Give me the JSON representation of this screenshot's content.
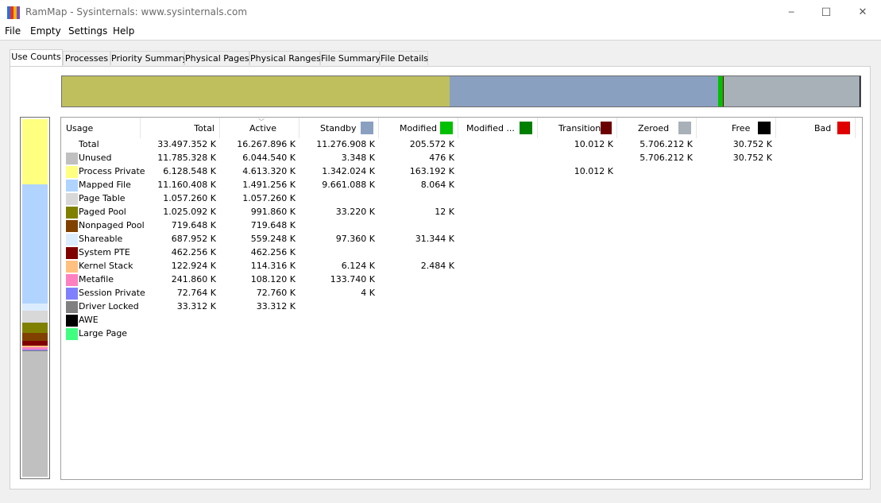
{
  "window": {
    "title": "RamMap - Sysinternals: www.sysinternals.com",
    "icon_colors": [
      "#2f6fd6",
      "#e6332a",
      "#f2b705",
      "#7a4fb8"
    ],
    "controls": {
      "minimize": "─",
      "maximize": "☐",
      "close": "✕"
    }
  },
  "menu": [
    "File",
    "Empty",
    "Settings",
    "Help"
  ],
  "tabs": [
    "Use Counts",
    "Processes",
    "Priority Summary",
    "Physical Pages",
    "Physical Ranges",
    "File Summary",
    "File Details"
  ],
  "active_tab": "Use Counts",
  "columns": [
    {
      "label": "Usage",
      "color": null
    },
    {
      "label": "Total",
      "color": null
    },
    {
      "label": "Active",
      "color": null,
      "sorted": true
    },
    {
      "label": "Standby",
      "color": "#8aa0c0"
    },
    {
      "label": "Modified",
      "color": "#00c000"
    },
    {
      "label": "Modified ...",
      "color": "#008000"
    },
    {
      "label": "Transition",
      "color": "#6b0000"
    },
    {
      "label": "Zeroed",
      "color": "#a8b0b8"
    },
    {
      "label": "Free",
      "color": "#000000"
    },
    {
      "label": "Bad",
      "color": "#e00000"
    }
  ],
  "rows": [
    {
      "name": "Total",
      "color": null,
      "values": [
        "33.497.352 K",
        "16.267.896 K",
        "11.276.908 K",
        "205.572 K",
        "",
        "10.012 K",
        "5.706.212 K",
        "30.752 K",
        ""
      ]
    },
    {
      "name": "Unused",
      "color": "#c0c0c0",
      "values": [
        "11.785.328 K",
        "6.044.540 K",
        "3.348 K",
        "476 K",
        "",
        "",
        "5.706.212 K",
        "30.752 K",
        ""
      ]
    },
    {
      "name": "Process Private",
      "color": "#ffff80",
      "values": [
        "6.128.548 K",
        "4.613.320 K",
        "1.342.024 K",
        "163.192 K",
        "",
        "10.012 K",
        "",
        "",
        ""
      ]
    },
    {
      "name": "Mapped File",
      "color": "#b0d4ff",
      "values": [
        "11.160.408 K",
        "1.491.256 K",
        "9.661.088 K",
        "8.064 K",
        "",
        "",
        "",
        "",
        ""
      ]
    },
    {
      "name": "Page Table",
      "color": "#d8d8d8",
      "values": [
        "1.057.260 K",
        "1.057.260 K",
        "",
        "",
        "",
        "",
        "",
        "",
        ""
      ]
    },
    {
      "name": "Paged Pool",
      "color": "#808000",
      "values": [
        "1.025.092 K",
        "991.860 K",
        "33.220 K",
        "12 K",
        "",
        "",
        "",
        "",
        ""
      ]
    },
    {
      "name": "Nonpaged Pool",
      "color": "#804000",
      "values": [
        "719.648 K",
        "719.648 K",
        "",
        "",
        "",
        "",
        "",
        "",
        ""
      ]
    },
    {
      "name": "Shareable",
      "color": "#dcecff",
      "values": [
        "687.952 K",
        "559.248 K",
        "97.360 K",
        "31.344 K",
        "",
        "",
        "",
        "",
        ""
      ]
    },
    {
      "name": "System PTE",
      "color": "#800000",
      "values": [
        "462.256 K",
        "462.256 K",
        "",
        "",
        "",
        "",
        "",
        "",
        ""
      ]
    },
    {
      "name": "Kernel Stack",
      "color": "#ffc080",
      "values": [
        "122.924 K",
        "114.316 K",
        "6.124 K",
        "2.484 K",
        "",
        "",
        "",
        "",
        ""
      ]
    },
    {
      "name": "Metafile",
      "color": "#ff80c0",
      "values": [
        "241.860 K",
        "108.120 K",
        "133.740 K",
        "",
        "",
        "",
        "",
        "",
        ""
      ]
    },
    {
      "name": "Session Private",
      "color": "#8080ff",
      "values": [
        "72.764 K",
        "72.760 K",
        "4 K",
        "",
        "",
        "",
        "",
        "",
        ""
      ]
    },
    {
      "name": "Driver Locked",
      "color": "#808080",
      "values": [
        "33.312 K",
        "33.312 K",
        "",
        "",
        "",
        "",
        "",
        "",
        ""
      ]
    },
    {
      "name": "AWE",
      "color": "#000000",
      "values": [
        "",
        "",
        "",
        "",
        "",
        "",
        "",
        "",
        ""
      ]
    },
    {
      "name": "Large Page",
      "color": "#40ff80",
      "values": [
        "",
        "",
        "",
        "",
        "",
        "",
        "",
        "",
        ""
      ]
    }
  ],
  "top_bar": [
    {
      "kind": "Active",
      "color": "#bfbf5e",
      "fraction": 0.4856
    },
    {
      "kind": "Standby",
      "color": "#8aa0c0",
      "fraction": 0.3366
    },
    {
      "kind": "Modified",
      "color": "#00c000",
      "fraction": 0.0061
    },
    {
      "kind": "Modified no write",
      "color": "#008000",
      "fraction": 0.0
    },
    {
      "kind": "Transition",
      "color": "#6b0000",
      "fraction": 0.0003
    },
    {
      "kind": "Zeroed",
      "color": "#a8b0b8",
      "fraction": 0.1703
    },
    {
      "kind": "Free",
      "color": "#000000",
      "fraction": 0.0009
    }
  ],
  "left_bar": [
    {
      "kind": "Process Private",
      "color": "#ffff80",
      "fraction": 0.183
    },
    {
      "kind": "Mapped File",
      "color": "#b0d4ff",
      "fraction": 0.3332
    },
    {
      "kind": "Shareable",
      "color": "#dcecff",
      "fraction": 0.0205
    },
    {
      "kind": "Page Table",
      "color": "#d8d8d8",
      "fraction": 0.0316
    },
    {
      "kind": "Paged Pool",
      "color": "#808000",
      "fraction": 0.0306
    },
    {
      "kind": "Nonpaged Pool",
      "color": "#804000",
      "fraction": 0.0215
    },
    {
      "kind": "System PTE",
      "color": "#800000",
      "fraction": 0.0138
    },
    {
      "kind": "Kernel Stack",
      "color": "#ffc080",
      "fraction": 0.0037
    },
    {
      "kind": "Metafile",
      "color": "#ff80c0",
      "fraction": 0.0072
    },
    {
      "kind": "Session Private",
      "color": "#8080ff",
      "fraction": 0.0022
    },
    {
      "kind": "Driver Locked",
      "color": "#808080",
      "fraction": 0.001
    },
    {
      "kind": "Unused",
      "color": "#c0c0c0",
      "fraction": 0.3518
    }
  ]
}
